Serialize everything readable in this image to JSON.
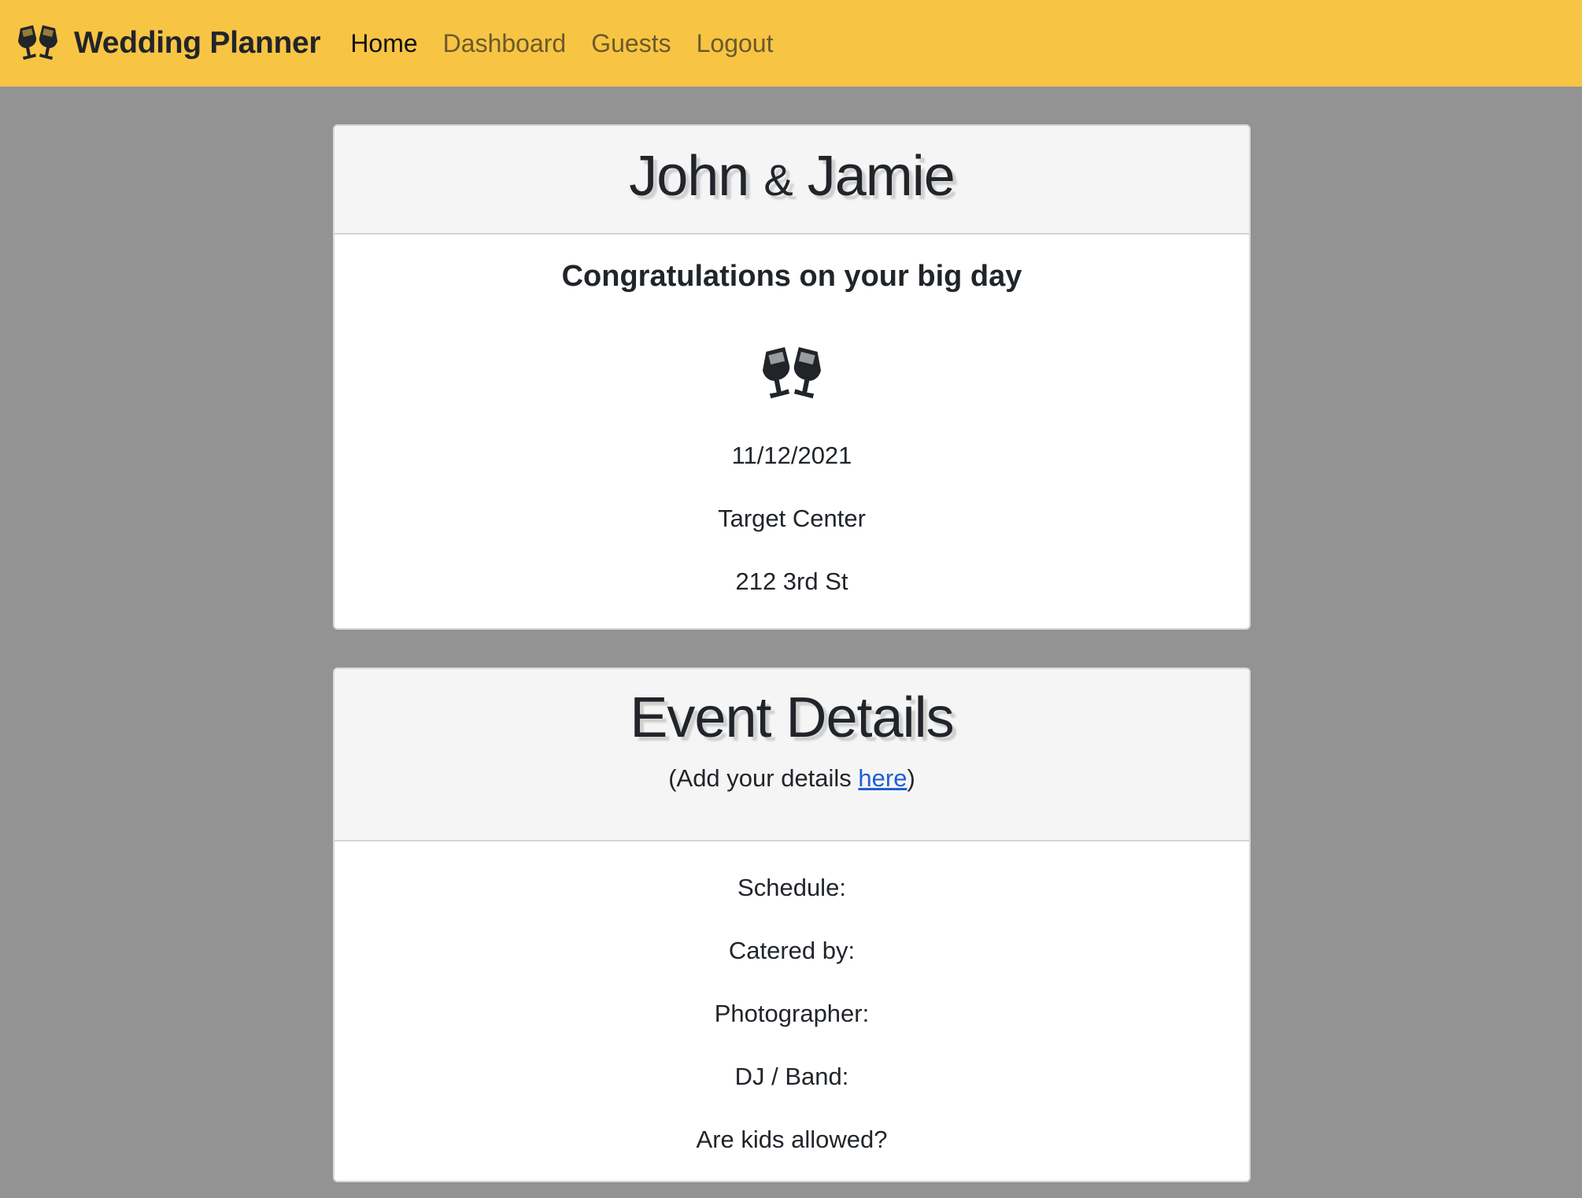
{
  "navbar": {
    "brand_icon": "champagne-glasses-icon",
    "brand": "Wedding Planner",
    "links": [
      {
        "label": "Home",
        "active": true
      },
      {
        "label": "Dashboard",
        "active": false
      },
      {
        "label": "Guests",
        "active": false
      },
      {
        "label": "Logout",
        "active": false
      }
    ]
  },
  "couple_card": {
    "name_1": "John",
    "ampersand": "&",
    "name_2": "Jamie",
    "greeting": "Congratulations on your big day",
    "icon": "champagne-glasses-icon",
    "date": "11/12/2021",
    "venue": "Target Center",
    "address": "212 3rd St"
  },
  "event_card": {
    "title": "Event Details",
    "add_prefix": "(Add your details ",
    "add_link": "here",
    "add_suffix": ")",
    "fields": [
      "Schedule:",
      "Catered by:",
      "Photographer:",
      "DJ / Band:",
      "Are kids allowed?"
    ]
  },
  "colors": {
    "navbar_bg": "#f8c444",
    "page_bg": "#939393",
    "link": "#1f5fd6"
  }
}
